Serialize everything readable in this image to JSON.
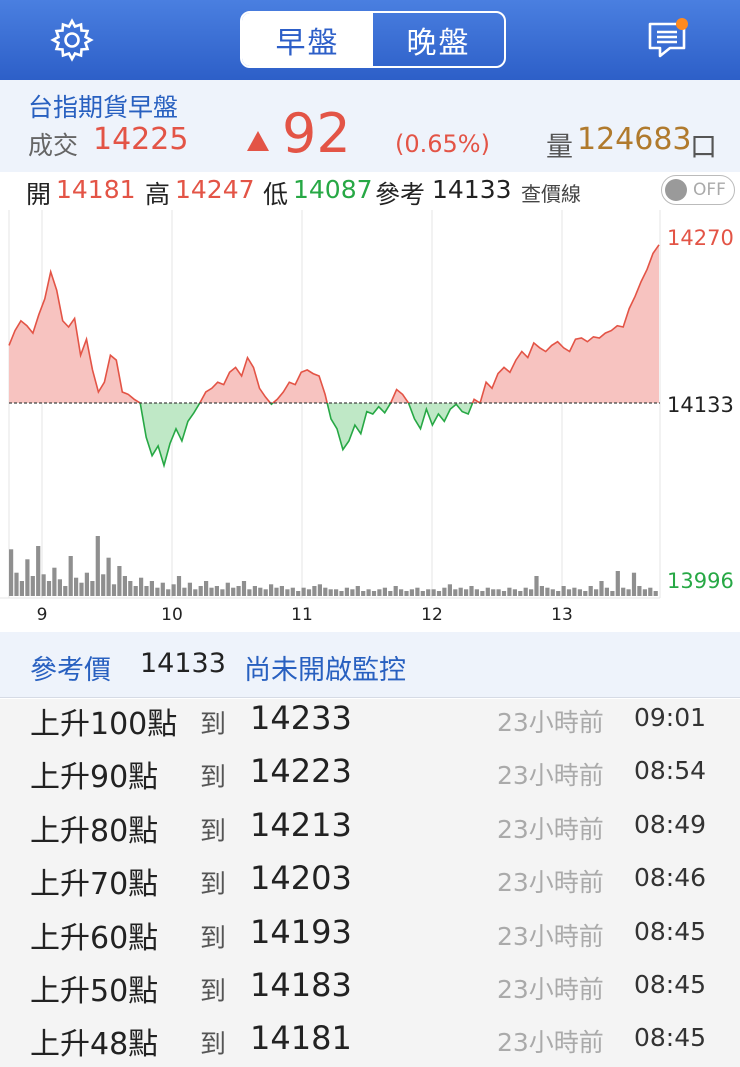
{
  "header": {
    "segments": [
      {
        "label": "早盤",
        "active": true
      },
      {
        "label": "晚盤",
        "active": false
      }
    ],
    "settings_icon": "gear-icon",
    "message_icon": "message-icon",
    "accent": "#2d5fc8",
    "badge_color": "#ff8a1f"
  },
  "quote": {
    "title": "台指期貨早盤",
    "deal_label": "成交",
    "deal_value": "14225",
    "change": "92",
    "change_pct": "(0.65%)",
    "volume_label": "量",
    "volume_value": "124683",
    "volume_unit": "口",
    "up_color": "#e35446",
    "down_color": "#27a845"
  },
  "ohlc": {
    "open_label": "開",
    "open": "14181",
    "high_label": "高",
    "high": "14247",
    "low_label": "低",
    "low": "14087",
    "ref_label": "參考",
    "ref": "14133",
    "check_line_label": "查價線",
    "toggle_label": "OFF"
  },
  "chart_data": {
    "type": "area",
    "y_axis_labels": [
      "14270",
      "14133",
      "13996"
    ],
    "x_ticks": [
      "9",
      "10",
      "11",
      "12",
      "13"
    ],
    "ylim": [
      13996,
      14270
    ],
    "reference": 14133,
    "price": [
      14180,
      14192,
      14200,
      14196,
      14190,
      14205,
      14218,
      14240,
      14225,
      14200,
      14195,
      14202,
      14172,
      14185,
      14160,
      14142,
      14150,
      14172,
      14168,
      14142,
      14140,
      14136,
      14133,
      14105,
      14090,
      14098,
      14082,
      14100,
      14112,
      14102,
      14118,
      14125,
      14133,
      14142,
      14145,
      14150,
      14148,
      14158,
      14162,
      14155,
      14170,
      14162,
      14145,
      14138,
      14132,
      14136,
      14142,
      14150,
      14148,
      14158,
      14160,
      14157,
      14155,
      14140,
      14120,
      14112,
      14095,
      14102,
      14115,
      14108,
      14126,
      14124,
      14130,
      14125,
      14133,
      14144,
      14140,
      14133,
      14120,
      14112,
      14128,
      14115,
      14124,
      14118,
      14128,
      14132,
      14126,
      14124,
      14136,
      14133,
      14150,
      14145,
      14157,
      14162,
      14158,
      14168,
      14175,
      14170,
      14182,
      14178,
      14175,
      14180,
      14183,
      14178,
      14175,
      14185,
      14186,
      14183,
      14187,
      14186,
      14190,
      14192,
      14196,
      14195,
      14210,
      14220,
      14232,
      14242,
      14255,
      14262
    ],
    "volume": [
      28,
      14,
      9,
      22,
      12,
      30,
      13,
      9,
      17,
      10,
      6,
      24,
      11,
      8,
      14,
      9,
      36,
      13,
      23,
      7,
      18,
      12,
      9,
      6,
      11,
      6,
      9,
      5,
      8,
      4,
      7,
      12,
      5,
      8,
      4,
      6,
      9,
      5,
      6,
      4,
      8,
      5,
      6,
      9,
      4,
      6,
      5,
      4,
      7,
      5,
      6,
      4,
      5,
      3,
      5,
      4,
      6,
      7,
      5,
      4,
      4,
      3,
      5,
      4,
      6,
      3,
      4,
      3,
      4,
      5,
      3,
      6,
      4,
      3,
      4,
      5,
      3,
      4,
      4,
      3,
      5,
      7,
      4,
      5,
      4,
      6,
      4,
      3,
      5,
      4,
      4,
      3,
      5,
      4,
      3,
      5,
      4,
      12,
      6,
      5,
      4,
      3,
      6,
      4,
      5,
      4,
      3,
      6,
      4,
      9,
      5,
      3,
      15,
      5,
      4,
      14,
      6,
      4,
      5,
      3
    ]
  },
  "monitor": {
    "ref_label": "參考價",
    "ref_value": "14133",
    "status": "尚未開啟監控"
  },
  "alerts": [
    {
      "direction": "上升100點",
      "to": "到",
      "value": "14233",
      "ago": "23小時前",
      "time": "09:01"
    },
    {
      "direction": "上升90點",
      "to": "到",
      "value": "14223",
      "ago": "23小時前",
      "time": "08:54"
    },
    {
      "direction": "上升80點",
      "to": "到",
      "value": "14213",
      "ago": "23小時前",
      "time": "08:49"
    },
    {
      "direction": "上升70點",
      "to": "到",
      "value": "14203",
      "ago": "23小時前",
      "time": "08:46"
    },
    {
      "direction": "上升60點",
      "to": "到",
      "value": "14193",
      "ago": "23小時前",
      "time": "08:45"
    },
    {
      "direction": "上升50點",
      "to": "到",
      "value": "14183",
      "ago": "23小時前",
      "time": "08:45"
    },
    {
      "direction": "上升48點",
      "to": "到",
      "value": "14181",
      "ago": "23小時前",
      "time": "08:45"
    }
  ]
}
